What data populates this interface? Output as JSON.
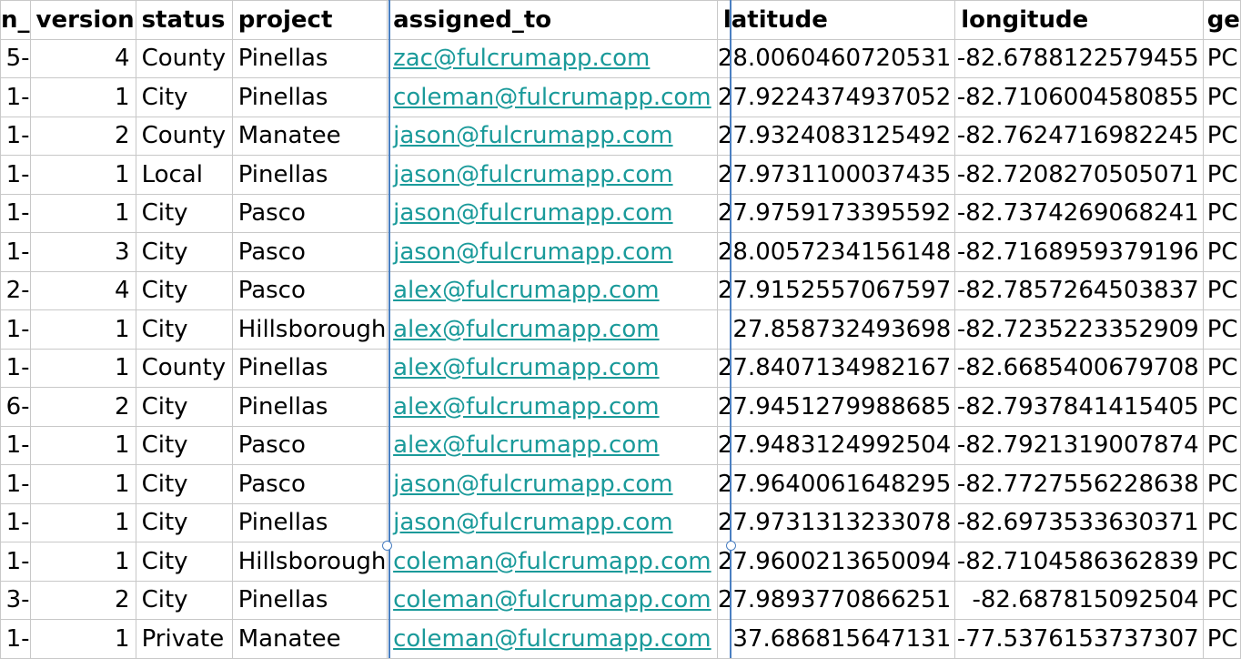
{
  "headers": {
    "partial_left": "n_",
    "version": "version",
    "status": "status",
    "project": "project",
    "assigned_to": "assigned_to",
    "latitude": "latitude",
    "longitude": "longitude",
    "partial_right": "ge"
  },
  "rows": [
    {
      "left": "5-",
      "version": "4",
      "status": "County",
      "project": "Pinellas",
      "assigned_to": "zac@fulcrumapp.com",
      "latitude": "28.0060460720531",
      "longitude": "-82.6788122579455",
      "right": "PC"
    },
    {
      "left": "1-",
      "version": "1",
      "status": "City",
      "project": "Pinellas",
      "assigned_to": "coleman@fulcrumapp.com",
      "latitude": "27.9224374937052",
      "longitude": "-82.7106004580855",
      "right": "PC"
    },
    {
      "left": "1-",
      "version": "2",
      "status": "County",
      "project": "Manatee",
      "assigned_to": "jason@fulcrumapp.com",
      "latitude": "27.9324083125492",
      "longitude": "-82.7624716982245",
      "right": "PC"
    },
    {
      "left": "1-",
      "version": "1",
      "status": "Local",
      "project": "Pinellas",
      "assigned_to": "jason@fulcrumapp.com",
      "latitude": "27.9731100037435",
      "longitude": "-82.7208270505071",
      "right": "PC"
    },
    {
      "left": "1-",
      "version": "1",
      "status": "City",
      "project": "Pasco",
      "assigned_to": "jason@fulcrumapp.com",
      "latitude": "27.9759173395592",
      "longitude": "-82.7374269068241",
      "right": "PC"
    },
    {
      "left": "1-",
      "version": "3",
      "status": "City",
      "project": "Pasco",
      "assigned_to": "jason@fulcrumapp.com",
      "latitude": "28.0057234156148",
      "longitude": "-82.7168959379196",
      "right": "PC"
    },
    {
      "left": "2-",
      "version": "4",
      "status": "City",
      "project": "Pasco",
      "assigned_to": "alex@fulcrumapp.com",
      "latitude": "27.9152557067597",
      "longitude": "-82.7857264503837",
      "right": "PC"
    },
    {
      "left": "1-",
      "version": "1",
      "status": "City",
      "project": "Hillsborough",
      "assigned_to": "alex@fulcrumapp.com",
      "latitude": "27.858732493698",
      "longitude": "-82.7235223352909",
      "right": "PC"
    },
    {
      "left": "1-",
      "version": "1",
      "status": "County",
      "project": "Pinellas",
      "assigned_to": "alex@fulcrumapp.com",
      "latitude": "27.8407134982167",
      "longitude": "-82.6685400679708",
      "right": "PC"
    },
    {
      "left": "6-",
      "version": "2",
      "status": "City",
      "project": "Pinellas",
      "assigned_to": "alex@fulcrumapp.com",
      "latitude": "27.9451279988685",
      "longitude": "-82.7937841415405",
      "right": "PC"
    },
    {
      "left": "1-",
      "version": "1",
      "status": "City",
      "project": "Pasco",
      "assigned_to": "alex@fulcrumapp.com",
      "latitude": "27.9483124992504",
      "longitude": "-82.7921319007874",
      "right": "PC"
    },
    {
      "left": "1-",
      "version": "1",
      "status": "City",
      "project": "Pasco",
      "assigned_to": "jason@fulcrumapp.com",
      "latitude": "27.9640061648295",
      "longitude": "-82.7727556228638",
      "right": "PC"
    },
    {
      "left": "1-",
      "version": "1",
      "status": "City",
      "project": "Pinellas",
      "assigned_to": "jason@fulcrumapp.com",
      "latitude": "27.9731313233078",
      "longitude": "-82.6973533630371",
      "right": "PC"
    },
    {
      "left": "1-",
      "version": "1",
      "status": "City",
      "project": "Hillsborough",
      "assigned_to": "coleman@fulcrumapp.com",
      "latitude": "27.9600213650094",
      "longitude": "-82.7104586362839",
      "right": "PC"
    },
    {
      "left": "3-",
      "version": "2",
      "status": "City",
      "project": "Pinellas",
      "assigned_to": "coleman@fulcrumapp.com",
      "latitude": "27.9893770866251",
      "longitude": "-82.687815092504",
      "right": "PC"
    },
    {
      "left": "1-",
      "version": "1",
      "status": "Private",
      "project": "Manatee",
      "assigned_to": "coleman@fulcrumapp.com",
      "latitude": "37.686815647131",
      "longitude": "-77.5376153737307",
      "right": "PC"
    }
  ],
  "colors": {
    "link": "#1a9a9a",
    "grid": "#c8c8c8",
    "selection": "#4a7fc1"
  }
}
